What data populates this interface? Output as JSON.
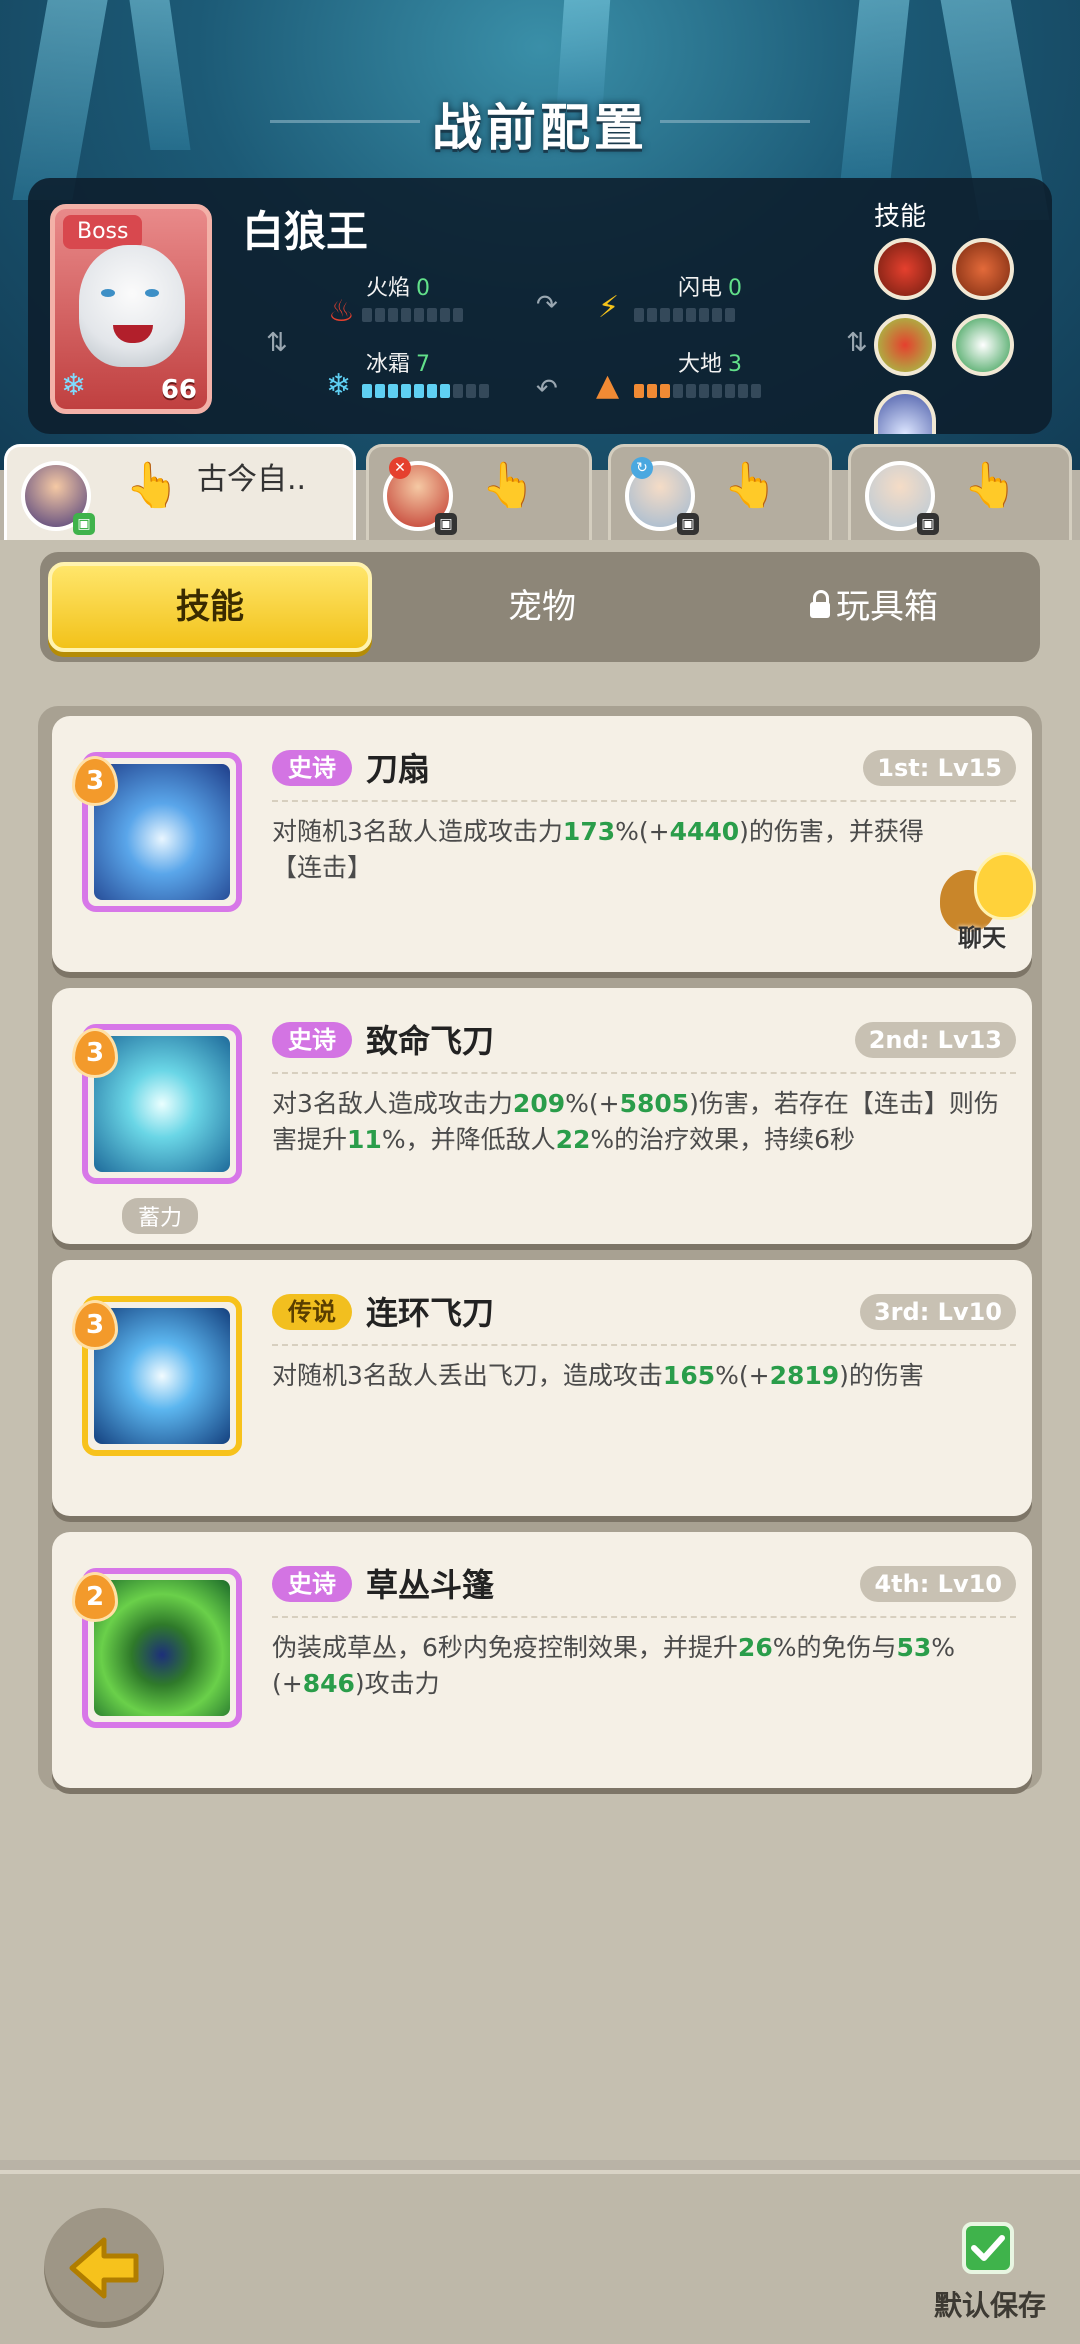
{
  "screen": {
    "title": "战前配置"
  },
  "boss": {
    "tag": "Boss",
    "name": "白狼王",
    "level": "66",
    "stats": {
      "fire": {
        "label": "火焰",
        "value": "0"
      },
      "lightning": {
        "label": "闪电",
        "value": "0"
      },
      "ice": {
        "label": "冰霜",
        "value": "7"
      },
      "earth": {
        "label": "大地",
        "value": "3"
      }
    },
    "skills_label": "技能",
    "colors": {
      "ice": "#5fd0f3",
      "earth": "#f08a34",
      "fire": "#e5402e",
      "lightning": "#f5c31a"
    }
  },
  "heroes": [
    {
      "name": "古今自..",
      "active": true
    },
    {
      "name": "",
      "active": false
    },
    {
      "name": "",
      "active": false
    },
    {
      "name": "",
      "active": false
    }
  ],
  "tabs": {
    "skills": "技能",
    "pets": "宠物",
    "toybox": "玩具箱"
  },
  "skills": [
    {
      "badge": "3",
      "rarity": "史诗",
      "name": "刀扇",
      "rank": "1st: Lv15",
      "desc": [
        "对随机3名敌人造成攻击力",
        "173",
        "%(+",
        "4440",
        ")的伤害，并获得【连击】"
      ]
    },
    {
      "badge": "3",
      "rarity": "史诗",
      "name": "致命飞刀",
      "rank": "2nd: Lv13",
      "sub_tag": "蓄力",
      "desc": [
        "对3名敌人造成攻击力",
        "209",
        "%(+",
        "5805",
        ")伤害，若存在【连击】则伤害提升",
        "11",
        "%，并降低敌人",
        "22",
        "%的治疗效果，持续6秒"
      ]
    },
    {
      "badge": "3",
      "rarity": "传说",
      "name": "连环飞刀",
      "rank": "3rd: Lv10",
      "desc": [
        "对随机3名敌人丢出飞刀，造成攻击",
        "165",
        "%(+",
        "2819",
        ")的伤害"
      ]
    },
    {
      "badge": "2",
      "rarity": "史诗",
      "name": "草丛斗篷",
      "rank": "4th: Lv10",
      "desc": [
        "伪装成草丛，6秒内免疫控制效果，并提升",
        "26",
        "%的免伤与",
        "53",
        "%(+",
        "846",
        ")攻击力"
      ]
    }
  ],
  "chat": {
    "label": "聊天"
  },
  "footer": {
    "save_label": "默认保存"
  }
}
